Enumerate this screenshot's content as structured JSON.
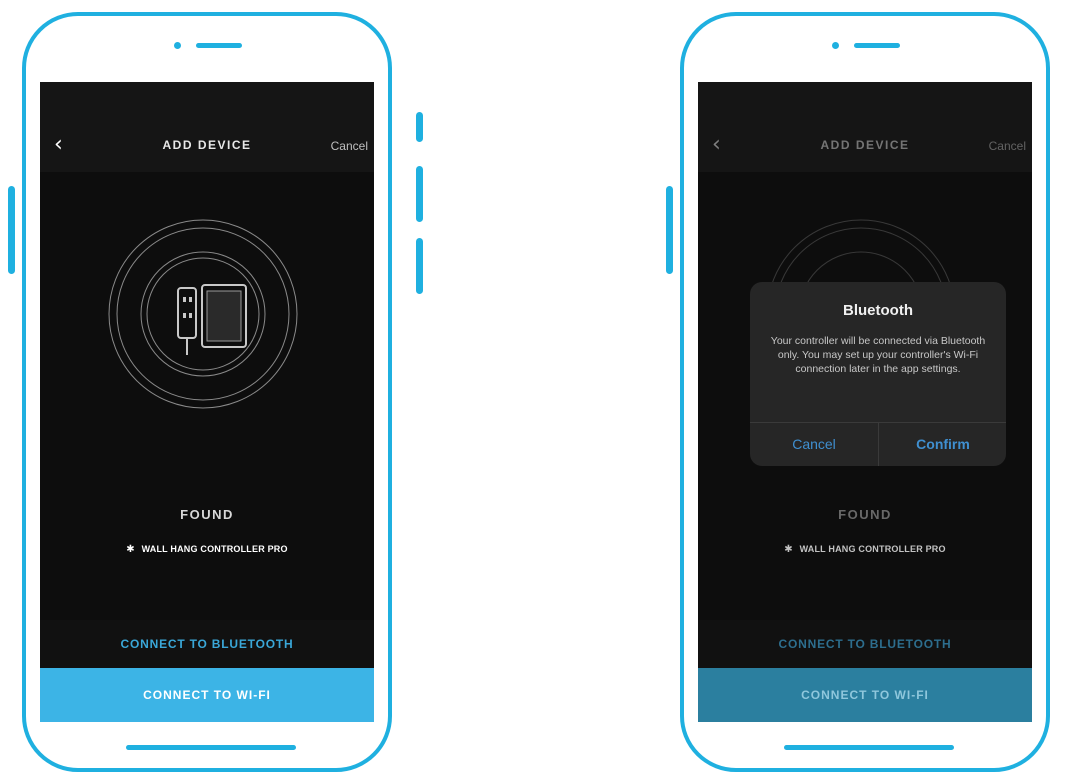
{
  "colors": {
    "accent": "#1fb0e0",
    "wifi_button": "#3cb4e6",
    "link_blue": "#3aa7d8",
    "screen_bg": "#0d0d0d",
    "dialog_bg": "#262626"
  },
  "phones": [
    {
      "navbar": {
        "back_icon": "chevron-left-icon",
        "back_glyph": "‹",
        "title": "ADD DEVICE",
        "cancel": "Cancel"
      },
      "illustration_icon": "device-rings-icon",
      "status": "FOUND",
      "device": {
        "icons": "bluetooth-icon wifi-icon",
        "icon_glyphs": "✱ ",
        "name": "WALL HANG CONTROLLER PRO"
      },
      "buttons": {
        "bluetooth": "CONNECT TO BLUETOOTH",
        "wifi": "CONNECT TO WI-FI"
      }
    },
    {
      "navbar": {
        "back_icon": "chevron-left-icon",
        "back_glyph": "‹",
        "title": "ADD DEVICE",
        "cancel": "Cancel"
      },
      "illustration_icon": "device-rings-icon",
      "status": "FOUND",
      "device": {
        "icons": "bluetooth-icon wifi-icon",
        "icon_glyphs": "✱ ",
        "name": "WALL HANG CONTROLLER PRO"
      },
      "buttons": {
        "bluetooth": "CONNECT TO BLUETOOTH",
        "wifi": "CONNECT TO WI-FI"
      },
      "dialog": {
        "title": "Bluetooth",
        "message": "Your controller will be connected via Bluetooth only. You may set up your controller's Wi-Fi connection later in the app settings.",
        "cancel": "Cancel",
        "confirm": "Confirm"
      }
    }
  ]
}
